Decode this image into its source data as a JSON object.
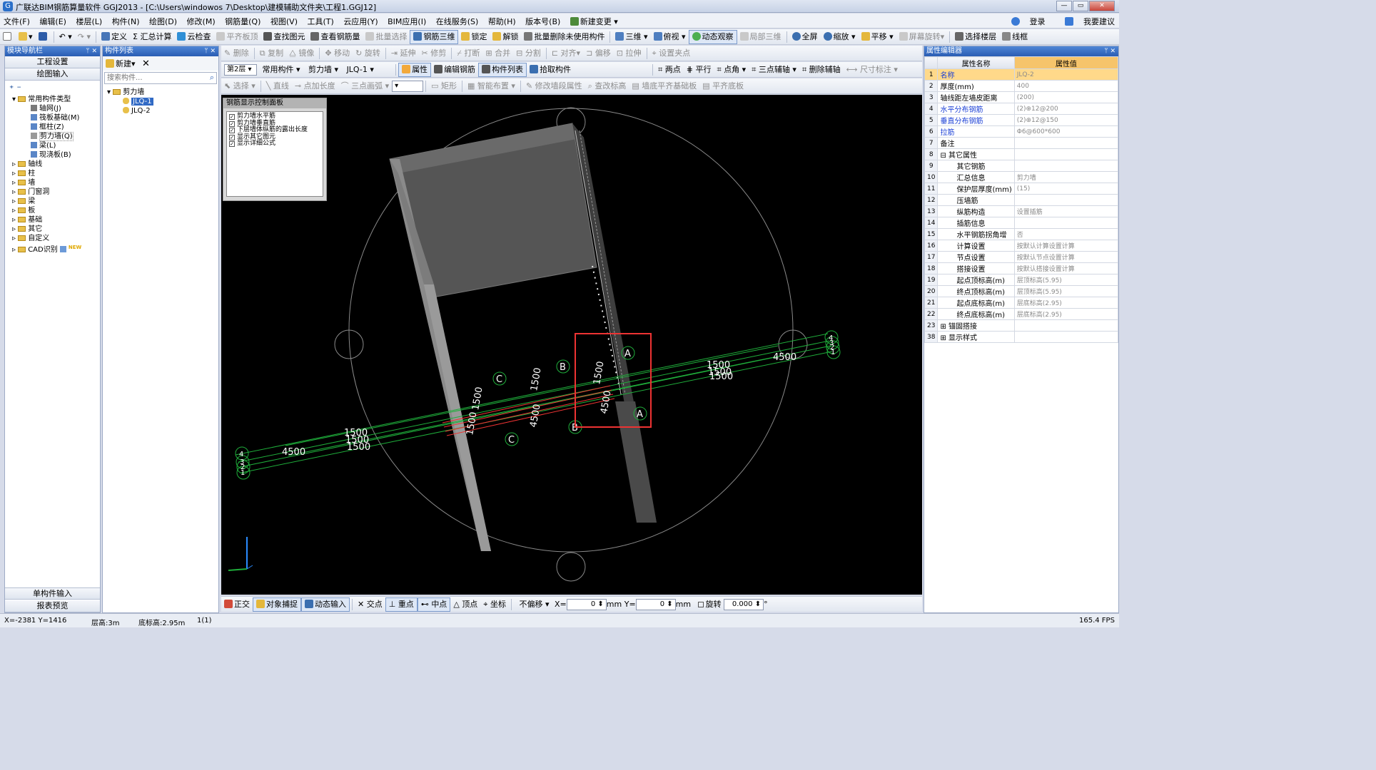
{
  "window": {
    "title": "广联达BIM钢筋算量软件 GGJ2013 - [C:\\Users\\windowos 7\\Desktop\\建模辅助文件夹\\工程1.GGJ12]",
    "controls": [
      "—",
      "▭",
      "✕"
    ]
  },
  "menu": {
    "items": [
      "文件(F)",
      "编辑(E)",
      "楼层(L)",
      "构件(N)",
      "绘图(D)",
      "修改(M)",
      "钢筋量(Q)",
      "视图(V)",
      "工具(T)",
      "云应用(Y)",
      "BIM应用(I)",
      "在线服务(S)",
      "帮助(H)",
      "版本号(B)",
      "新建变更"
    ],
    "login": "登录",
    "suggest": "我要建议"
  },
  "toolbar1": [
    "定义",
    "Σ 汇总计算",
    "云检查",
    "平齐板顶",
    "查找图元",
    "查看钢筋量",
    "批量选择",
    "钢筋三维",
    "锁定",
    "解锁",
    "批量删除未使用构件",
    "三维",
    "俯视",
    "动态观察",
    "局部三维",
    "全屏",
    "缩放",
    "平移",
    "屏幕旋转",
    "选择楼层",
    "线框"
  ],
  "toolbar2": [
    "删除",
    "复制",
    "镜像",
    "移动",
    "旋转",
    "延伸",
    "修剪",
    "打断",
    "合并",
    "分割",
    "对齐",
    "偏移",
    "拉伸",
    "设置夹点"
  ],
  "toolbar3": {
    "floor": "第2层",
    "category": "常用构件",
    "type": "剪力墙",
    "component": "JLQ-1",
    "buttons": [
      "属性",
      "编辑钢筋",
      "构件列表",
      "拾取构件",
      "两点",
      "平行",
      "点角",
      "三点辅轴",
      "删除辅轴",
      "尺寸标注"
    ]
  },
  "toolbar4": [
    "选择",
    "直线",
    "点加长度",
    "三点画弧",
    "矩形",
    "智能布置",
    "修改墙段属性",
    "查改标高",
    "墙底平齐基础板",
    "平齐底板"
  ],
  "left_panel": {
    "title": "模块导航栏",
    "btn_project": "工程设置",
    "btn_draw": "绘图输入",
    "tree": {
      "root": "常用构件类型",
      "children": [
        "轴网(J)",
        "筏板基础(M)",
        "框柱(Z)",
        "剪力墙(Q)",
        "梁(L)",
        "现浇板(B)"
      ],
      "groups": [
        "轴线",
        "柱",
        "墙",
        "门窗洞",
        "梁",
        "板",
        "基础",
        "其它",
        "自定义",
        "CAD识别"
      ],
      "new_badge": "NEW"
    },
    "btn_single": "单构件输入",
    "btn_report": "报表预览"
  },
  "comp_panel": {
    "title": "构件列表",
    "new_label": "新建",
    "search_placeholder": "搜索构件...",
    "tree_root": "剪力墙",
    "items": [
      "JLQ-1",
      "JLQ-2"
    ]
  },
  "control_panel": {
    "title": "钢筋显示控制面板",
    "options": [
      "剪力墙水平筋",
      "剪力墙垂直筋",
      "下层墙体纵筋的露出长度",
      "显示其它图元",
      "显示详细公式"
    ]
  },
  "viewport_labels": {
    "dims": [
      "1500",
      "1500",
      "1500",
      "4500",
      "1500",
      "1500",
      "1500",
      "4500",
      "1500",
      "1500",
      "4500",
      "1500",
      "1500",
      "4500"
    ],
    "axes": [
      "A",
      "B",
      "C",
      "C",
      "B",
      "A",
      "1",
      "2",
      "3",
      "4",
      "1",
      "2",
      "3",
      "4"
    ]
  },
  "props": {
    "title": "属性编辑器",
    "col_name": "属性名称",
    "col_value": "属性值",
    "rows": [
      {
        "idx": "1",
        "name": "名称",
        "value": "JLQ-2",
        "blue": true
      },
      {
        "idx": "2",
        "name": "厚度(mm)",
        "value": "400",
        "blue": false
      },
      {
        "idx": "3",
        "name": "轴线距左墙皮距离",
        "value": "(200)",
        "blue": false
      },
      {
        "idx": "4",
        "name": "水平分布钢筋",
        "value": "(2)⊕12@200",
        "blue": true
      },
      {
        "idx": "5",
        "name": "垂直分布钢筋",
        "value": "(2)⊕12@150",
        "blue": true
      },
      {
        "idx": "6",
        "name": "拉筋",
        "value": "Φ6@600*600",
        "blue": true
      },
      {
        "idx": "7",
        "name": "备注",
        "value": "",
        "blue": false
      },
      {
        "idx": "8",
        "name": "⊟ 其它属性",
        "value": "",
        "blue": false
      },
      {
        "idx": "9",
        "name": "其它钢筋",
        "value": "",
        "blue": false
      },
      {
        "idx": "10",
        "name": "汇总信息",
        "value": "剪力墙",
        "blue": false
      },
      {
        "idx": "11",
        "name": "保护层厚度(mm)",
        "value": "(15)",
        "blue": false
      },
      {
        "idx": "12",
        "name": "压墙筋",
        "value": "",
        "blue": false
      },
      {
        "idx": "13",
        "name": "纵筋构造",
        "value": "设置插筋",
        "blue": false
      },
      {
        "idx": "14",
        "name": "插筋信息",
        "value": "",
        "blue": false
      },
      {
        "idx": "15",
        "name": "水平钢筋拐角增",
        "value": "否",
        "blue": false
      },
      {
        "idx": "16",
        "name": "计算设置",
        "value": "按默认计算设置计算",
        "blue": false
      },
      {
        "idx": "17",
        "name": "节点设置",
        "value": "按默认节点设置计算",
        "blue": false
      },
      {
        "idx": "18",
        "name": "搭接设置",
        "value": "按默认搭接设置计算",
        "blue": false
      },
      {
        "idx": "19",
        "name": "起点顶标高(m)",
        "value": "层顶标高(5.95)",
        "blue": false
      },
      {
        "idx": "20",
        "name": "终点顶标高(m)",
        "value": "层顶标高(5.95)",
        "blue": false
      },
      {
        "idx": "21",
        "name": "起点底标高(m)",
        "value": "层底标高(2.95)",
        "blue": false
      },
      {
        "idx": "22",
        "name": "终点底标高(m)",
        "value": "层底标高(2.95)",
        "blue": false
      },
      {
        "idx": "23",
        "name": "⊞ 锚固搭接",
        "value": "",
        "blue": false
      },
      {
        "idx": "38",
        "name": "⊞ 显示样式",
        "value": "",
        "blue": false
      }
    ]
  },
  "snapbar": {
    "items": [
      "正交",
      "对象捕捉",
      "动态输入",
      "交点",
      "重点",
      "中点",
      "顶点",
      "坐标"
    ],
    "offset": "不偏移",
    "x_label": "X=",
    "x_value": "0",
    "y_label": "Y=",
    "y_value": "0",
    "unit": "mm",
    "rotate_label": "旋转",
    "rotate_value": "0.000",
    "deg": "°"
  },
  "status": {
    "coords": "X=-2381  Y=1416",
    "floor_height": "层高:3m",
    "base_elev": "底标高:2.95m",
    "count": "1(1)",
    "fps": "165.4 FPS"
  }
}
